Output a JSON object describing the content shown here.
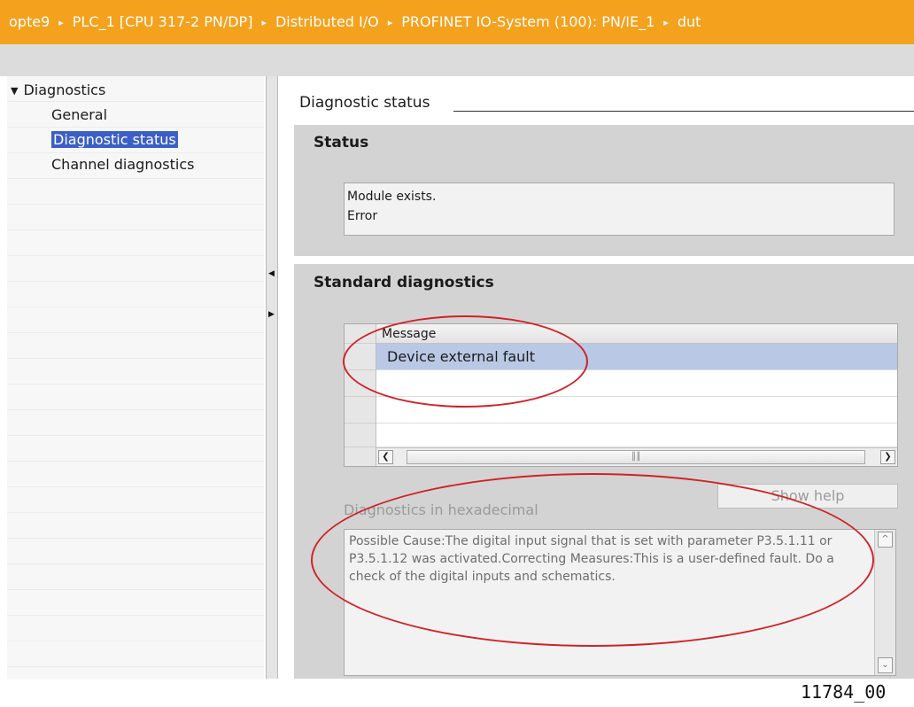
{
  "breadcrumb": {
    "items": [
      "opte9",
      "PLC_1 [CPU 317-2 PN/DP]",
      "Distributed I/O",
      "PROFINET IO-System (100): PN/IE_1",
      "dut"
    ],
    "separator_icon": "triangle-right-icon",
    "bar_color": "#f4a11d"
  },
  "nav": {
    "root_label": "Diagnostics",
    "items": [
      "General",
      "Diagnostic status",
      "Channel diagnostics"
    ],
    "selected_index": 1
  },
  "content": {
    "heading": "Diagnostic status",
    "status_panel": {
      "title": "Status",
      "lines": [
        "Module exists.",
        "Error"
      ]
    },
    "std_panel": {
      "title": "Standard diagnostics",
      "column_header": "Message",
      "rows": [
        "Device external fault",
        "",
        "",
        ""
      ],
      "selected_row": 0
    },
    "show_help_label": "Show help",
    "hex_label": "Diagnostics in hexadecimal",
    "hex_text": "Possible Cause:The digital input signal that is set with parameter P3.5.1.11 or P3.5.1.12 was activated.Correcting Measures:This is a user-defined fault. Do a check of the digital inputs and schematics."
  },
  "footer_id": "11784_00",
  "colors": {
    "selection": "#3b5fc6",
    "row_selection": "#b9c9e5",
    "annotation": "#cf2227"
  }
}
